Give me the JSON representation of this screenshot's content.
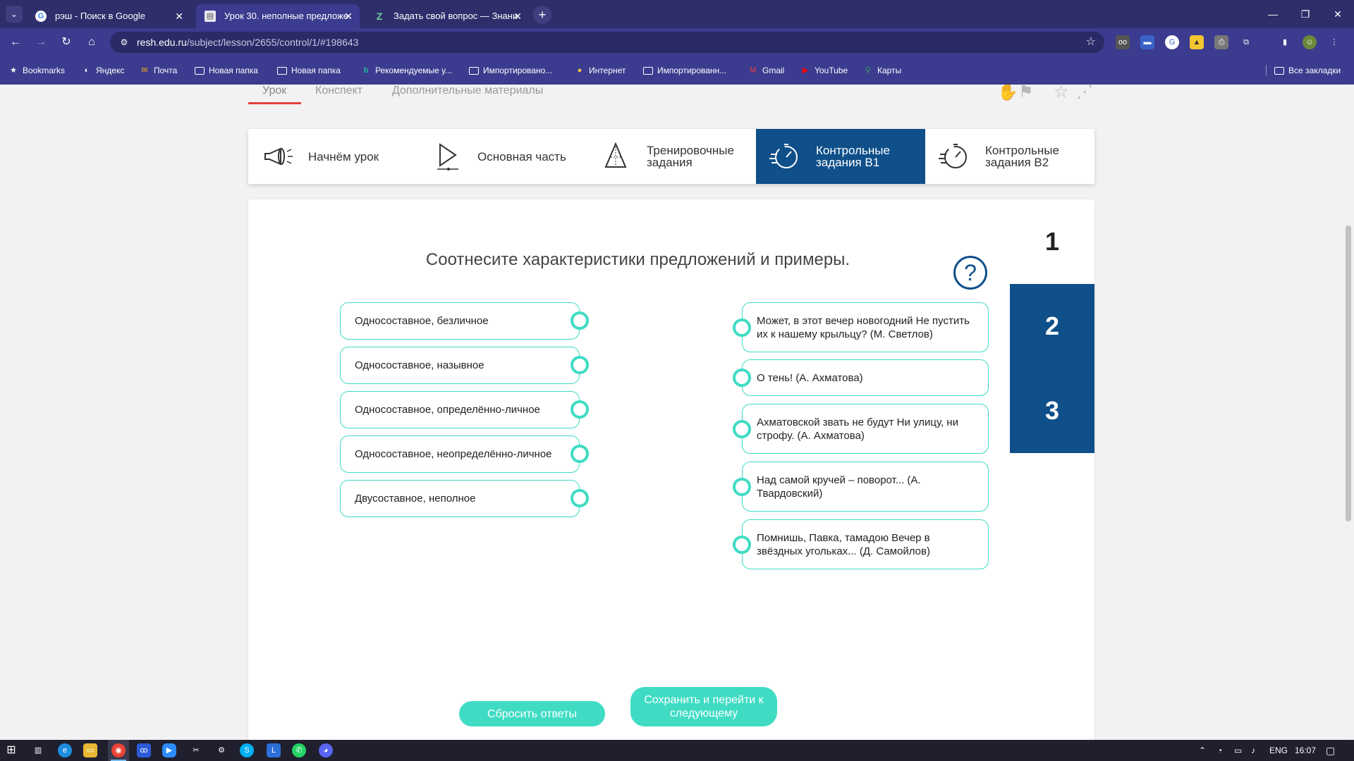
{
  "browser": {
    "tabs": [
      {
        "title": "рэш - Поиск в Google",
        "favicon": "google-icon",
        "active": false
      },
      {
        "title": "Урок 30. неполные предложе",
        "favicon": "document-icon",
        "active": true
      },
      {
        "title": "Задать свой вопрос — Знани",
        "favicon": "znanija-icon",
        "active": false
      }
    ],
    "url_host": "resh.edu.ru",
    "url_path": "/subject/lesson/2655/control/1/#198643",
    "bookmarks": [
      {
        "label": "Bookmarks",
        "icon": "star-icon"
      },
      {
        "label": "Яндекс",
        "icon": "yandex-icon"
      },
      {
        "label": "Почта",
        "icon": "mail-icon"
      },
      {
        "label": "Новая папка",
        "icon": "folder-icon"
      },
      {
        "label": "Новая папка",
        "icon": "folder-icon"
      },
      {
        "label": "Рекомендуемые у...",
        "icon": "bing-icon"
      },
      {
        "label": "Импортировано...",
        "icon": "folder-icon"
      },
      {
        "label": "Интернет",
        "icon": "globe-icon"
      },
      {
        "label": "Импортированн...",
        "icon": "folder-icon"
      },
      {
        "label": "Gmail",
        "icon": "gmail-icon"
      },
      {
        "label": "YouTube",
        "icon": "youtube-icon"
      },
      {
        "label": "Карты",
        "icon": "maps-icon"
      }
    ],
    "all_bookmarks": "Все закладки"
  },
  "lesson": {
    "subnav": [
      "Урок",
      "Конспект",
      "Дополнительные материалы"
    ],
    "steps": [
      {
        "label": "Начнём урок",
        "icon": "megaphone-icon"
      },
      {
        "label": "Основная часть",
        "icon": "play-icon"
      },
      {
        "label": "Тренировочные задания",
        "icon": "pyramid-icon"
      },
      {
        "label": "Контрольные задания В1",
        "icon": "stopwatch-icon"
      },
      {
        "label": "Контрольные задания В2",
        "icon": "stopwatch-icon"
      }
    ],
    "question": "Соотнесите характеристики предложений и примеры.",
    "help_symbol": "?",
    "task_numbers": [
      "1",
      "2",
      "3"
    ],
    "left_items": [
      "Односоставное, безличное",
      "Односоставное, назывное",
      "Односоставное, определённо-личное",
      "Односоставное, неопределённо-личное",
      "Двусоставное, неполное"
    ],
    "right_items": [
      "Может, в этот вечер новогодний Не пустить их к нашему крыльцу? (М. Светлов)",
      "О тень! (А. Ахматова)",
      "Ахматовской звать не будут Ни улицу, ни строфу. (А. Ахматова)",
      "Над самой кручей – поворот... (А. Твардовский)",
      "Помнишь, Павка, тамадою Вечер в звёздных угольках... (Д. Самойлов)"
    ],
    "reset_label": "Сбросить ответы",
    "save_label": "Сохранить и перейти к следующему"
  },
  "taskbar": {
    "lang": "ENG",
    "time": "16:07"
  },
  "colors": {
    "accent_teal": "#3fdcc3",
    "brand_blue": "#0f4f8a",
    "browser_frame": "#3b3b8f"
  }
}
